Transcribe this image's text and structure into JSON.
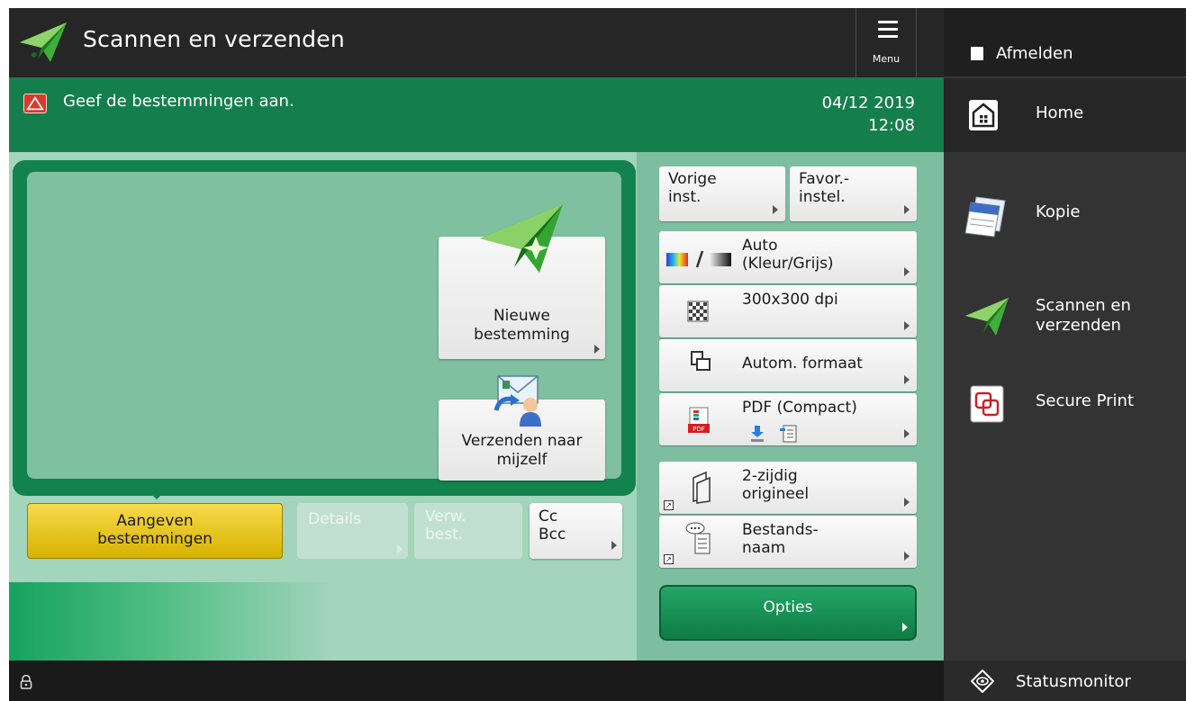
{
  "header": {
    "title": "Scannen en verzenden",
    "menu_label": "Menu",
    "app_icon": "paper-plane-icon"
  },
  "message_bar": {
    "message": "Geef de bestemmingen aan.",
    "date": "04/12 2019",
    "time": "12:08",
    "icon": "warning-icon"
  },
  "destination_panel": {
    "new_destination": {
      "line1": "Nieuwe",
      "line2": "bestemming"
    },
    "send_to_self": {
      "line1": "Verzenden naar",
      "line2": "mijzelf"
    }
  },
  "tabs": {
    "specify": {
      "line1": "Aangeven",
      "line2": "bestemmingen"
    },
    "details": "Details",
    "verw": {
      "line1": "Verw.",
      "line2": "best."
    },
    "cc": {
      "line1": "Cc",
      "line2": "Bcc"
    }
  },
  "settings": {
    "previous": {
      "line1": "Vorige",
      "line2": "inst."
    },
    "favorites": {
      "line1": "Favor.-",
      "line2": "instel."
    },
    "color": {
      "line1": "Auto",
      "line2": "(Kleur/Grijs)"
    },
    "resolution": "300x300 dpi",
    "size": "Autom. formaat",
    "format": "PDF (Compact)",
    "duplex": {
      "line1": "2-zijdig",
      "line2": "origineel"
    },
    "filename": {
      "line1": "Bestands-",
      "line2": "naam"
    },
    "options": "Opties"
  },
  "sidebar": {
    "logout": "Afmelden",
    "home": "Home",
    "items": [
      {
        "label_line1": "Kopie",
        "label_line2": "",
        "icon": "copy-icon"
      },
      {
        "label_line1": "Scannen en",
        "label_line2": "verzenden",
        "icon": "paper-plane-icon"
      },
      {
        "label_line1": "Secure Print",
        "label_line2": "",
        "icon": "secure-print-icon"
      }
    ]
  },
  "bottom_bar": {
    "status_monitor": "Statusmonitor"
  },
  "colors": {
    "accent_green": "#147f4c",
    "panel_green": "#7fc0a1",
    "primary_button_yellow": "#f2d43a",
    "options_green": "#1a9558"
  }
}
